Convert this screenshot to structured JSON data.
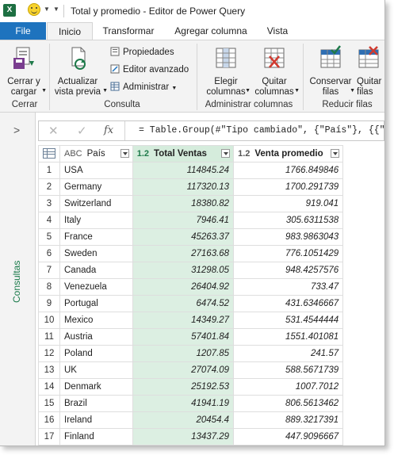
{
  "window": {
    "title": "Total y promedio - Editor de Power Query",
    "app_icon": "X"
  },
  "tabs": [
    "File",
    "Inicio",
    "Transformar",
    "Agregar columna",
    "Vista"
  ],
  "ribbon": {
    "cerrar_cargar": "Cerrar y\ncargar",
    "actualizar": "Actualizar\nvista previa",
    "propiedades": "Propiedades",
    "editor_avanzado": "Editor avanzado",
    "administrar": "Administrar",
    "elegir_columnas": "Elegir\ncolumnas",
    "quitar_columnas": "Quitar\ncolumnas",
    "conservar_filas": "Conservar\nfilas",
    "quitar_filas": "Quitar\nfilas",
    "groups": [
      "Cerrar",
      "Consulta",
      "Administrar columnas",
      "Reducir filas"
    ]
  },
  "left_panel": {
    "label": "Consultas"
  },
  "formula_bar": {
    "formula": "= Table.Group(#\"Tipo cambiado\", {\"País\"}, {{\"T"
  },
  "grid": {
    "columns": [
      {
        "type": "ABC",
        "name": "País"
      },
      {
        "type": "1.2",
        "name": "Total Ventas"
      },
      {
        "type": "1.2",
        "name": "Venta promedio"
      }
    ],
    "rows": [
      {
        "n": "1",
        "pais": "USA",
        "total": "114845.24",
        "prom": "1766.849846"
      },
      {
        "n": "2",
        "pais": "Germany",
        "total": "117320.13",
        "prom": "1700.291739"
      },
      {
        "n": "3",
        "pais": "Switzerland",
        "total": "18380.82",
        "prom": "919.041"
      },
      {
        "n": "4",
        "pais": "Italy",
        "total": "7946.41",
        "prom": "305.6311538"
      },
      {
        "n": "5",
        "pais": "France",
        "total": "45263.37",
        "prom": "983.9863043"
      },
      {
        "n": "6",
        "pais": "Sweden",
        "total": "27163.68",
        "prom": "776.1051429"
      },
      {
        "n": "7",
        "pais": "Canada",
        "total": "31298.05",
        "prom": "948.4257576"
      },
      {
        "n": "8",
        "pais": "Venezuela",
        "total": "26404.92",
        "prom": "733.47"
      },
      {
        "n": "9",
        "pais": "Portugal",
        "total": "6474.52",
        "prom": "431.6346667"
      },
      {
        "n": "10",
        "pais": "Mexico",
        "total": "14349.27",
        "prom": "531.4544444"
      },
      {
        "n": "11",
        "pais": "Austria",
        "total": "57401.84",
        "prom": "1551.401081"
      },
      {
        "n": "12",
        "pais": "Poland",
        "total": "1207.85",
        "prom": "241.57"
      },
      {
        "n": "13",
        "pais": "UK",
        "total": "27074.09",
        "prom": "588.5671739"
      },
      {
        "n": "14",
        "pais": "Denmark",
        "total": "25192.53",
        "prom": "1007.7012"
      },
      {
        "n": "15",
        "pais": "Brazil",
        "total": "41941.19",
        "prom": "806.5613462"
      },
      {
        "n": "16",
        "pais": "Ireland",
        "total": "20454.4",
        "prom": "889.3217391"
      },
      {
        "n": "17",
        "pais": "Finland",
        "total": "13437.29",
        "prom": "447.9096667"
      }
    ]
  },
  "colors": {
    "file_tab": "#1e73be",
    "selected_column": "#dcefe2",
    "accent_green": "#1e7a4a"
  }
}
